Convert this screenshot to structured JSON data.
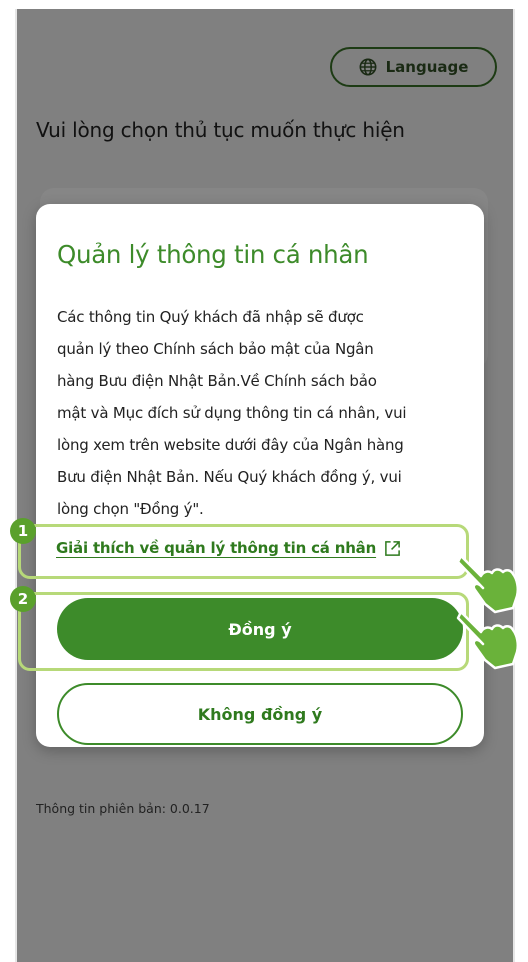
{
  "header": {
    "language_label": "Language"
  },
  "page": {
    "title": "Vui lòng chọn thủ tục muốn thực hiện",
    "version_text": "Thông tin phiên bản: 0.0.17"
  },
  "modal": {
    "title": "Quản lý thông tin cá nhân",
    "body": "Các thông tin Quý khách đã nhập sẽ được\nquản lý theo Chính sách bảo mật của Ngân\nhàng Bưu điện Nhật Bản.Về Chính sách bảo\nmật và Mục đích sử dụng thông tin cá nhân, vui\nlòng xem trên website dưới đây của Ngân hàng\nBưu điện Nhật Bản. Nếu Quý khách đồng ý, vui\nlòng chọn \"Đồng ý\".",
    "link_label": "Giải thích về quản lý thông tin cá nhân",
    "agree_label": "Đồng ý",
    "disagree_label": "Không đồng ý"
  },
  "annotations": {
    "step1": "1",
    "step2": "2"
  },
  "icons": {
    "language": "globe-icon",
    "link": "external-link-icon",
    "pointer": "pointing-hand-icon"
  },
  "colors": {
    "accent": "#3d8b2a",
    "highlight": "#b7d979",
    "overlay": "#808080"
  }
}
